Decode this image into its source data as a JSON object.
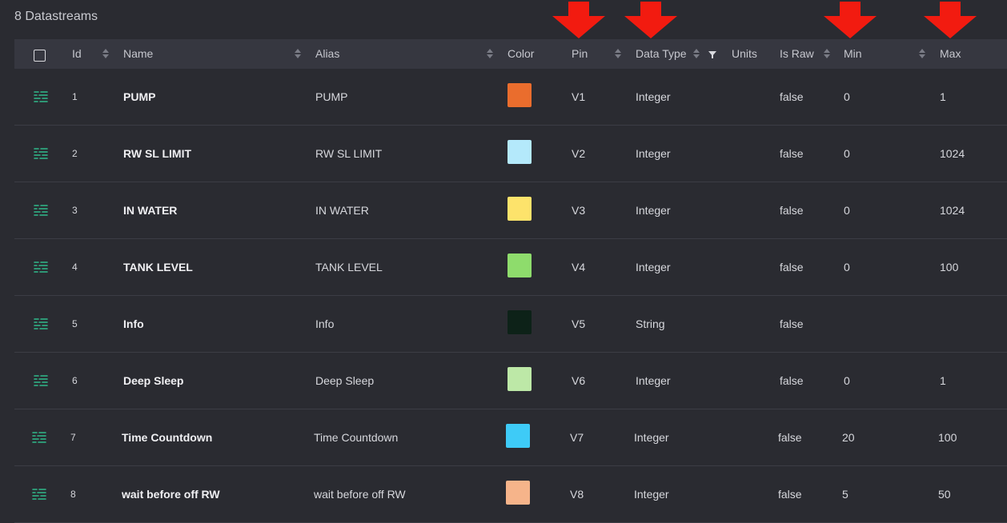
{
  "page": {
    "title": "8 Datastreams"
  },
  "header": {
    "id": "Id",
    "name": "Name",
    "alias": "Alias",
    "color": "Color",
    "pin": "Pin",
    "data_type": "Data Type",
    "units": "Units",
    "is_raw": "Is Raw",
    "min": "Min",
    "max": "Max"
  },
  "rows": [
    {
      "id": "1",
      "name": "PUMP",
      "alias": "PUMP",
      "color": "#ea6d2d",
      "pin": "V1",
      "type": "Integer",
      "raw": "false",
      "min": "0",
      "max": "1"
    },
    {
      "id": "2",
      "name": "RW SL LIMIT",
      "alias": "RW SL LIMIT",
      "color": "#b4e9fb",
      "pin": "V2",
      "type": "Integer",
      "raw": "false",
      "min": "0",
      "max": "1024"
    },
    {
      "id": "3",
      "name": "IN WATER",
      "alias": "IN WATER",
      "color": "#fde36b",
      "pin": "V3",
      "type": "Integer",
      "raw": "false",
      "min": "0",
      "max": "1024"
    },
    {
      "id": "4",
      "name": "TANK LEVEL",
      "alias": "TANK LEVEL",
      "color": "#8edc6c",
      "pin": "V4",
      "type": "Integer",
      "raw": "false",
      "min": "0",
      "max": "100"
    },
    {
      "id": "5",
      "name": "Info",
      "alias": "Info",
      "color": "#0d2218",
      "pin": "V5",
      "type": "String",
      "raw": "false",
      "min": "",
      "max": ""
    },
    {
      "id": "6",
      "name": "Deep Sleep",
      "alias": "Deep Sleep",
      "color": "#bde8a7",
      "pin": "V6",
      "type": "Integer",
      "raw": "false",
      "min": "0",
      "max": "1"
    },
    {
      "id": "7",
      "name": "Time Countdown",
      "alias": "Time Countdown",
      "color": "#3ecbf7",
      "pin": "V7",
      "type": "Integer",
      "raw": "false",
      "min": "20",
      "max": "100"
    },
    {
      "id": "8",
      "name": "wait before off RW",
      "alias": "wait before off RW",
      "color": "#f6b48a",
      "pin": "V8",
      "type": "Integer",
      "raw": "false",
      "min": "5",
      "max": "50"
    }
  ],
  "colors": {
    "accent": "#2fb98a",
    "annotation_arrow": "#f21b10",
    "background": "#2a2b31",
    "header_bg": "#363740"
  },
  "icons": {
    "row_icon": "datastream-icon",
    "annotation": "red-arrow-down-icon"
  }
}
